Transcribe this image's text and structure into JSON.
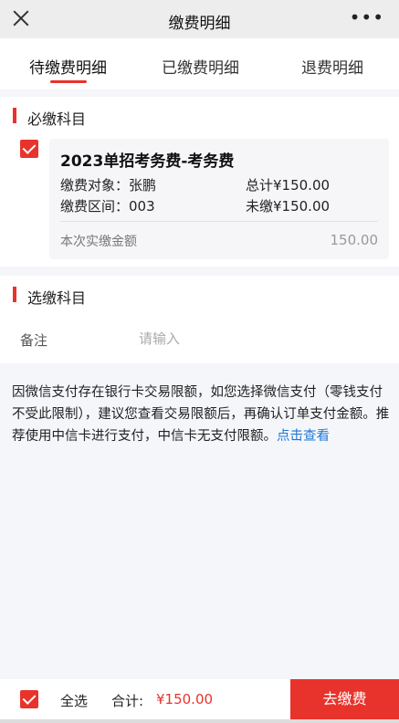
{
  "navbar": {
    "title": "缴费明细",
    "more": "•••"
  },
  "tabs": [
    {
      "label": "待缴费明细",
      "active": true
    },
    {
      "label": "已缴费明细",
      "active": false
    },
    {
      "label": "退费明细",
      "active": false
    }
  ],
  "required_section": {
    "title": "必缴科目",
    "item": {
      "checked": true,
      "name": "2023单招考务费-考务费",
      "payer": "缴费对象：张鹏",
      "total": "总计¥150.00",
      "range": "缴费区间：003",
      "unpaid": "未缴¥150.00",
      "pay_label": "本次实缴金额",
      "pay_value": "150.00"
    }
  },
  "optional_section": {
    "title": "选缴科目",
    "remark_label": "备注",
    "remark_placeholder": "请输入",
    "remark_value": ""
  },
  "notice": {
    "text": "因微信支付存在银行卡交易限额，如您选择微信支付（零钱支付不受此限制），建议您查看交易限额后，再确认订单支付金额。推荐使用中信卡进行支付，中信卡无支付限额。",
    "link": "点击查看"
  },
  "bottom_bar": {
    "select_all_checked": true,
    "select_all_label": "全选",
    "total_label": "合计:",
    "total_value": "¥150.00",
    "pay_button": "去缴费"
  },
  "colors": {
    "accent": "#e8332c",
    "link": "#1e78d7"
  }
}
